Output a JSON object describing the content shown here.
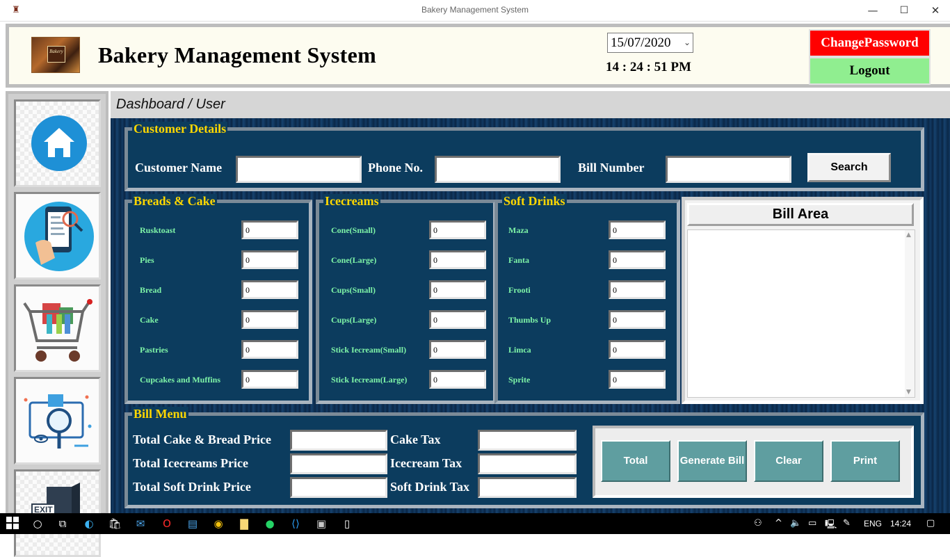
{
  "window": {
    "title": "Bakery Management System"
  },
  "header": {
    "app_title": "Bakery Management System",
    "logo_text": "Bakery",
    "date": "15/07/2020",
    "clock": "14 : 24 : 51 PM",
    "change_password_label": "ChangePassword",
    "logout_label": "Logout"
  },
  "breadcrumb": "Dashboard / User",
  "customer": {
    "section_title": "Customer Details",
    "name_label": "Customer Name",
    "phone_label": "Phone No.",
    "bill_label": "Bill Number",
    "name_value": "",
    "phone_value": "",
    "bill_value": "",
    "search_label": "Search"
  },
  "breads": {
    "title": "Breads & Cake",
    "items": [
      {
        "label": "Rusktoast",
        "value": "0"
      },
      {
        "label": "Pies",
        "value": "0"
      },
      {
        "label": "Bread",
        "value": "0"
      },
      {
        "label": "Cake",
        "value": "0"
      },
      {
        "label": "Pastries",
        "value": "0"
      },
      {
        "label": "Cupcakes and Muffins",
        "value": "0"
      }
    ]
  },
  "icecreams": {
    "title": "Icecreams",
    "items": [
      {
        "label": "Cone(Small)",
        "value": "0"
      },
      {
        "label": "Cone(Large)",
        "value": "0"
      },
      {
        "label": "Cups(Small)",
        "value": "0"
      },
      {
        "label": "Cups(Large)",
        "value": "0"
      },
      {
        "label": "Stick Iecream(Small)",
        "value": "0"
      },
      {
        "label": "Stick Iecream(Large)",
        "value": "0"
      }
    ]
  },
  "drinks": {
    "title": "Soft Drinks",
    "items": [
      {
        "label": "Maza",
        "value": "0"
      },
      {
        "label": "Fanta",
        "value": "0"
      },
      {
        "label": "Frooti",
        "value": "0"
      },
      {
        "label": "Thumbs Up",
        "value": "0"
      },
      {
        "label": "Limca",
        "value": "0"
      },
      {
        "label": "Sprite",
        "value": "0"
      }
    ]
  },
  "bill_area": {
    "title": "Bill Area"
  },
  "bill_menu": {
    "title": "Bill Menu",
    "cake_bread_price_label": "Total Cake & Bread Price",
    "icecreams_price_label": "Total Icecreams Price",
    "soft_drink_price_label": "Total Soft Drink Price",
    "cake_tax_label": "Cake Tax",
    "icecream_tax_label": "Icecream Tax",
    "soft_drink_tax_label": "Soft Drink Tax",
    "buttons": {
      "total": "Total",
      "generate": "Generate Bill",
      "clear": "Clear",
      "print": "Print"
    }
  },
  "sidebar": {
    "exit_label": "EXIT"
  },
  "taskbar": {
    "language": "ENG",
    "time": "14:24"
  }
}
